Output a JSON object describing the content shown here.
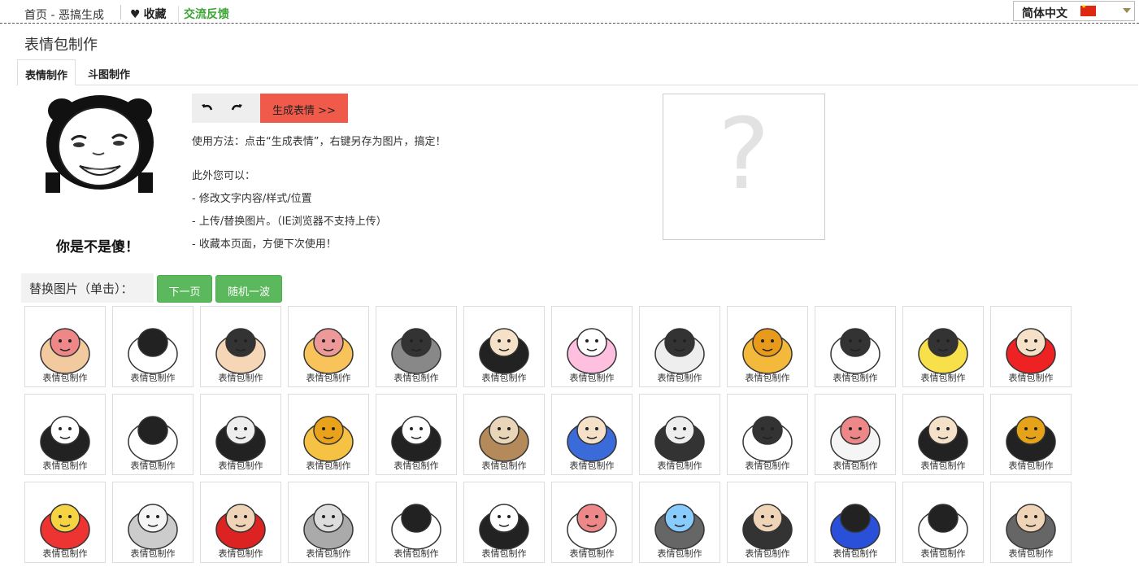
{
  "nav": {
    "home": "首页 - 恶搞生成",
    "favorite": "收藏",
    "feedback": "交流反馈",
    "language": "简体中文"
  },
  "page_title": "表情包制作",
  "tabs": [
    "表情制作",
    "斗图制作"
  ],
  "meme_caption": "你是不是傻！",
  "toolbar": {
    "generate": "生成表情 >>"
  },
  "instructions": {
    "usage": "使用方法：点击“生成表情”，右键另存为图片，搞定！",
    "extra_title": "此外您可以：",
    "extra_items": [
      "- 修改文字内容/样式/位置",
      "- 上传/替换图片。（IE浏览器不支持上传）",
      "- 收藏本页面，方便下次使用！"
    ]
  },
  "result_placeholder": "?",
  "replace": {
    "label": "替换图片（单击）：",
    "next": "下一页",
    "random": "随机一波"
  },
  "thumbnail_caption": "表情包制作",
  "colors": {
    "accent_red": "#f05a4a",
    "green": "#5cb85c",
    "feedback_green": "#3aa535"
  }
}
